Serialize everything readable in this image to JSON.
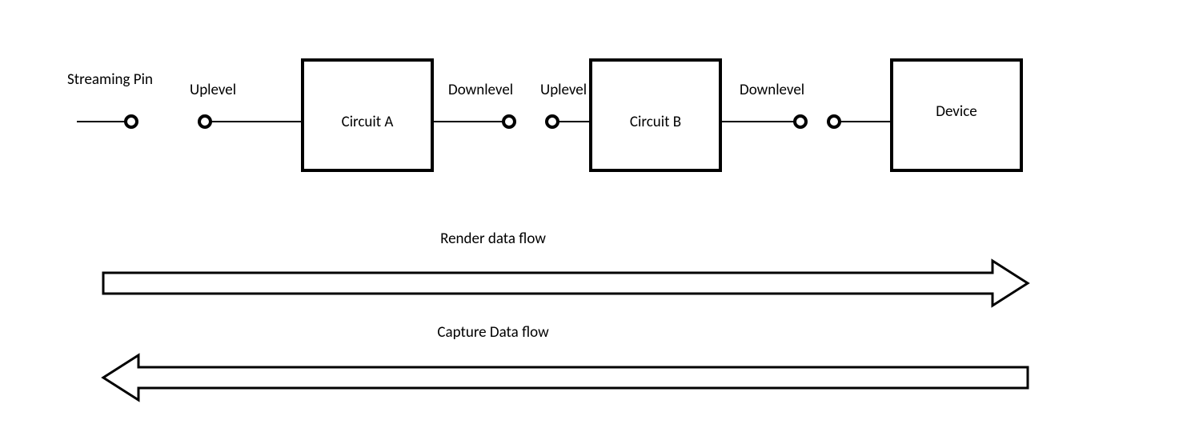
{
  "labels": {
    "streaming_pin": "Streaming Pin",
    "uplevel_1": "Uplevel",
    "circuit_a": "Circuit A",
    "downlevel_1": "Downlevel",
    "uplevel_2": "Uplevel",
    "circuit_b": "Circuit B",
    "downlevel_2": "Downlevel",
    "device": "Device",
    "render_flow": "Render data flow",
    "capture_flow": "Capture Data flow"
  },
  "diagram": {
    "description": "Signal chain showing Streaming Pin connected through uplevel/downlevel pins to Circuit A, then Circuit B, then Device. Two large block arrows below: Render data flow (left to right) and Capture data flow (right to left).",
    "nodes": [
      "Streaming Pin",
      "Uplevel",
      "Circuit A",
      "Downlevel",
      "Uplevel",
      "Circuit B",
      "Downlevel",
      "Device"
    ],
    "flows": [
      {
        "name": "Render data flow",
        "direction": "right"
      },
      {
        "name": "Capture Data flow",
        "direction": "left"
      }
    ]
  }
}
